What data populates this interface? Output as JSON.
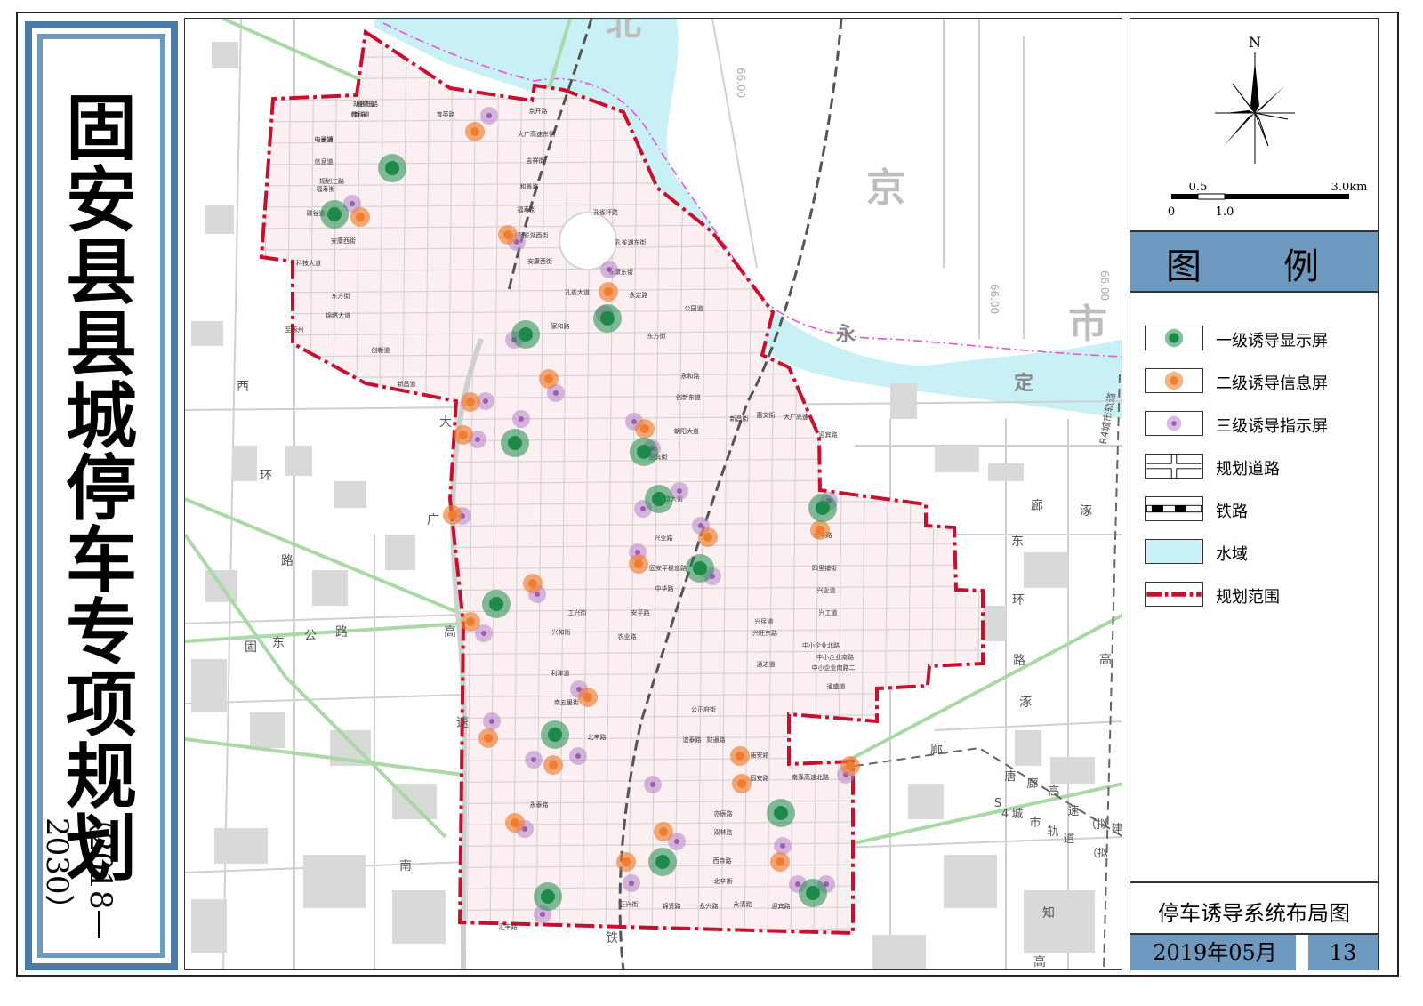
{
  "title": {
    "main": "固安县县城停车专项规划",
    "years": "（2018—2030）"
  },
  "compass": {
    "north": "N"
  },
  "scale": {
    "labels": [
      "0",
      "0.5",
      "1.0",
      "3.0km"
    ]
  },
  "legend": {
    "heading": "图　例",
    "items": [
      {
        "label": "一级诱导显示屏",
        "icon": "green-circle",
        "color": "#1e8a4a"
      },
      {
        "label": "二级诱导信息屏",
        "icon": "orange-circle",
        "color": "#ee7d2f"
      },
      {
        "label": "三级诱导指示屏",
        "icon": "purple-circle",
        "color": "#b784c8"
      },
      {
        "label": "规划道路",
        "icon": "road-symbol"
      },
      {
        "label": "铁路",
        "icon": "railway-symbol"
      },
      {
        "label": "水域",
        "icon": "water-symbol",
        "color": "#c9f0f5"
      },
      {
        "label": "规划范围",
        "icon": "boundary-symbol",
        "color": "#c8102e"
      }
    ]
  },
  "footer": {
    "drawing_title": "停车诱导系统布局图",
    "date": "2019年05月",
    "page": "13"
  },
  "map_labels": {
    "beijing": [
      "北",
      "京",
      "市"
    ],
    "yongding": [
      "永",
      "定"
    ],
    "west_ring": [
      "西",
      "环",
      "路"
    ],
    "expressway": [
      "大",
      "广",
      "高",
      "速"
    ],
    "gudong": [
      "固",
      "东",
      "公",
      "路"
    ],
    "south_railway": [
      "南",
      "铁"
    ],
    "east_ring": [
      "廊",
      "涿",
      "东",
      "环",
      "路",
      "高",
      "涿",
      "廊",
      "知",
      "高"
    ],
    "r4": "R4城市轨道",
    "s4": [
      "S",
      "4",
      "城",
      "市",
      "轨",
      "道"
    ],
    "tanglang": [
      "唐",
      "廊",
      "高",
      "速",
      "（拟",
      "建"
    ],
    "ni": "（拟",
    "elev": [
      "66.00",
      "66.00",
      "66.00"
    ],
    "roads": [
      "通顺道",
      "教科道",
      "电子道",
      "信息道",
      "规划三路",
      "福寿街",
      "碳谷道",
      "安康西街",
      "科技大道",
      "东方街",
      "锦绣大道",
      "创新道",
      "新昌道",
      "至涿州",
      "大广高速东侧",
      "京开路",
      "吉祥街",
      "和善路",
      "福寿街",
      "孔雀湖西街",
      "安康西街",
      "孔雀环路",
      "育英路",
      "孔雀湖东街",
      "安康东街",
      "永定路",
      "孔雀大道",
      "家和路",
      "公园道",
      "东方街",
      "永和路",
      "创新东道",
      "朝阳大道",
      "迎宾街",
      "友谊大街",
      "兴业路",
      "新昌街",
      "惠文街",
      "大广高速",
      "迎宾路",
      "固安平稳道路",
      "安平路",
      "中华路",
      "工兴街",
      "兴和街",
      "农业路",
      "利津道",
      "南五里街",
      "公正府街",
      "谊泰路",
      "财通路",
      "庙安路",
      "固安路",
      "南泽高速北路",
      "亦辰路",
      "双林路",
      "西寺路",
      "北辛街",
      "北辛路",
      "四里铺街",
      "兴业道",
      "兴工道",
      "兴民道",
      "兴旺东路",
      "中小企业北路",
      "中小企业南路",
      "中小企业南路二",
      "通盛道",
      "通达道",
      "正兴街",
      "锦贤路",
      "永兴路",
      "永清路",
      "迎宾路",
      "永泰路",
      "汇丰路",
      "北辛路",
      "胡各庄路",
      "新庙",
      "十里铺"
    ]
  },
  "markers": {
    "level1": [
      [
        440,
        188
      ],
      [
        375,
        240
      ],
      [
        590,
        375
      ],
      [
        682,
        357
      ],
      [
        578,
        497
      ],
      [
        723,
        507
      ],
      [
        740,
        560
      ],
      [
        924,
        570
      ],
      [
        786,
        638
      ],
      [
        557,
        678
      ],
      [
        623,
        825
      ],
      [
        877,
        913
      ],
      [
        744,
        968
      ],
      [
        615,
        1007
      ],
      [
        913,
        1003
      ]
    ],
    "level2": [
      [
        533,
        147
      ],
      [
        404,
        243
      ],
      [
        570,
        263
      ],
      [
        683,
        327
      ],
      [
        616,
        425
      ],
      [
        528,
        451
      ],
      [
        520,
        488
      ],
      [
        724,
        481
      ],
      [
        921,
        595
      ],
      [
        508,
        578
      ],
      [
        795,
        603
      ],
      [
        717,
        633
      ],
      [
        598,
        655
      ],
      [
        528,
        698
      ],
      [
        660,
        783
      ],
      [
        548,
        829
      ],
      [
        621,
        859
      ],
      [
        831,
        849
      ],
      [
        833,
        880
      ],
      [
        578,
        924
      ],
      [
        745,
        934
      ],
      [
        703,
        968
      ],
      [
        876,
        968
      ],
      [
        955,
        860
      ]
    ],
    "level3": [
      [
        549,
        129
      ],
      [
        395,
        228
      ],
      [
        580,
        271
      ],
      [
        684,
        302
      ],
      [
        679,
        352
      ],
      [
        577,
        381
      ],
      [
        624,
        441
      ],
      [
        545,
        450
      ],
      [
        585,
        470
      ],
      [
        536,
        493
      ],
      [
        712,
        473
      ],
      [
        732,
        503
      ],
      [
        763,
        551
      ],
      [
        931,
        562
      ],
      [
        722,
        571
      ],
      [
        519,
        579
      ],
      [
        787,
        590
      ],
      [
        716,
        620
      ],
      [
        800,
        647
      ],
      [
        603,
        667
      ],
      [
        543,
        711
      ],
      [
        650,
        774
      ],
      [
        552,
        810
      ],
      [
        649,
        849
      ],
      [
        599,
        853
      ],
      [
        733,
        881
      ],
      [
        589,
        931
      ],
      [
        760,
        945
      ],
      [
        879,
        950
      ],
      [
        709,
        992
      ],
      [
        896,
        993
      ],
      [
        928,
        993
      ],
      [
        609,
        1027
      ],
      [
        950,
        870
      ]
    ]
  }
}
